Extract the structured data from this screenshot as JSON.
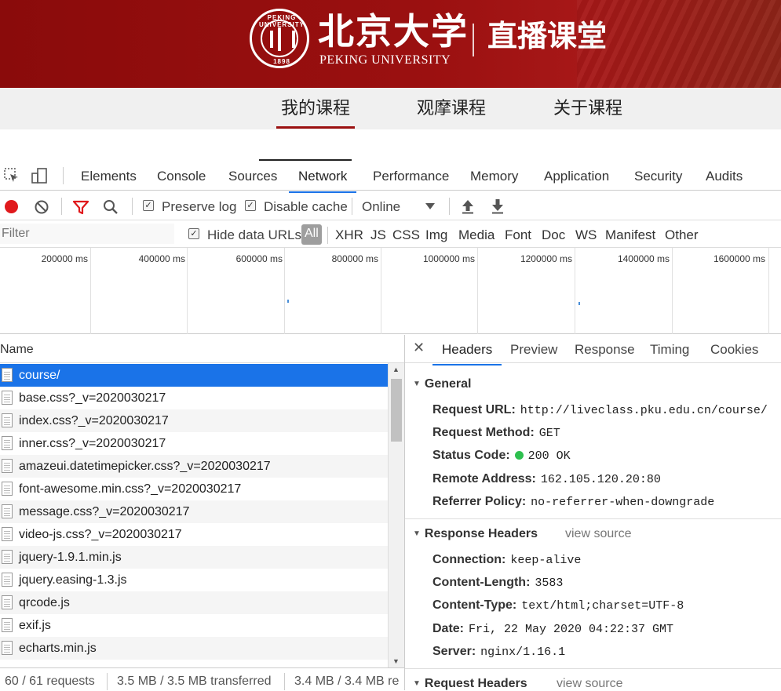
{
  "banner": {
    "seal_top": "PEKING UNIVERSITY",
    "seal_year": "1898",
    "brand_cn": "北京大学",
    "brand_en": "PEKING UNIVERSITY",
    "subtitle": "直播课堂"
  },
  "nav": {
    "items": [
      {
        "label": "我的课程",
        "active": true
      },
      {
        "label": "观摩课程",
        "active": false
      },
      {
        "label": "关于课程",
        "active": false
      }
    ]
  },
  "devtools": {
    "tabs": [
      "Elements",
      "Console",
      "Sources",
      "Network",
      "Performance",
      "Memory",
      "Application",
      "Security",
      "Audits"
    ],
    "active_tab": "Network",
    "toolbar": {
      "preserve_log": {
        "label": "Preserve log",
        "checked": true
      },
      "disable_cache": {
        "label": "Disable cache",
        "checked": true
      },
      "throttling": "Online"
    },
    "filter": {
      "placeholder": "Filter",
      "hide_data_urls": {
        "label": "Hide data URLs",
        "checked": true
      },
      "types": [
        "All",
        "XHR",
        "JS",
        "CSS",
        "Img",
        "Media",
        "Font",
        "Doc",
        "WS",
        "Manifest",
        "Other"
      ]
    },
    "overview_ticks": [
      "200000 ms",
      "400000 ms",
      "600000 ms",
      "800000 ms",
      "1000000 ms",
      "1200000 ms",
      "1400000 ms",
      "1600000 ms"
    ],
    "request_list": {
      "header": "Name",
      "rows": [
        "course/",
        "base.css?_v=2020030217",
        "index.css?_v=2020030217",
        "inner.css?_v=2020030217",
        "amazeui.datetimepicker.css?_v=2020030217",
        "font-awesome.min.css?_v=2020030217",
        "message.css?_v=2020030217",
        "video-js.css?_v=2020030217",
        "jquery-1.9.1.min.js",
        "jquery.easing-1.3.js",
        "qrcode.js",
        "exif.js",
        "echarts.min.js"
      ],
      "selected_index": 0
    },
    "status": {
      "requests": "60 / 61 requests",
      "transferred": "3.5 MB / 3.5 MB transferred",
      "resources": "3.4 MB / 3.4 MB re"
    },
    "details": {
      "tabs": [
        "Headers",
        "Preview",
        "Response",
        "Timing",
        "Cookies"
      ],
      "active_tab": "Headers",
      "general": {
        "title": "General",
        "request_url_k": "Request URL:",
        "request_url_v": "http://liveclass.pku.edu.cn/course/",
        "method_k": "Request Method:",
        "method_v": "GET",
        "status_k": "Status Code:",
        "status_v": "200 OK",
        "remote_k": "Remote Address:",
        "remote_v": "162.105.120.20:80",
        "referrer_k": "Referrer Policy:",
        "referrer_v": "no-referrer-when-downgrade"
      },
      "response_headers": {
        "title": "Response Headers",
        "view_source": "view source",
        "connection_k": "Connection:",
        "connection_v": "keep-alive",
        "length_k": "Content-Length:",
        "length_v": "3583",
        "type_k": "Content-Type:",
        "type_v": "text/html;charset=UTF-8",
        "date_k": "Date:",
        "date_v": "Fri, 22 May 2020 04:22:37 GMT",
        "server_k": "Server:",
        "server_v": "nginx/1.16.1"
      },
      "request_headers": {
        "title": "Request Headers",
        "view_source": "view source"
      }
    }
  },
  "colors": {
    "banner_red": "#9b1010",
    "accent_blue": "#1a73e8",
    "record_red": "#e0191c",
    "status_green": "#2ec04f"
  }
}
